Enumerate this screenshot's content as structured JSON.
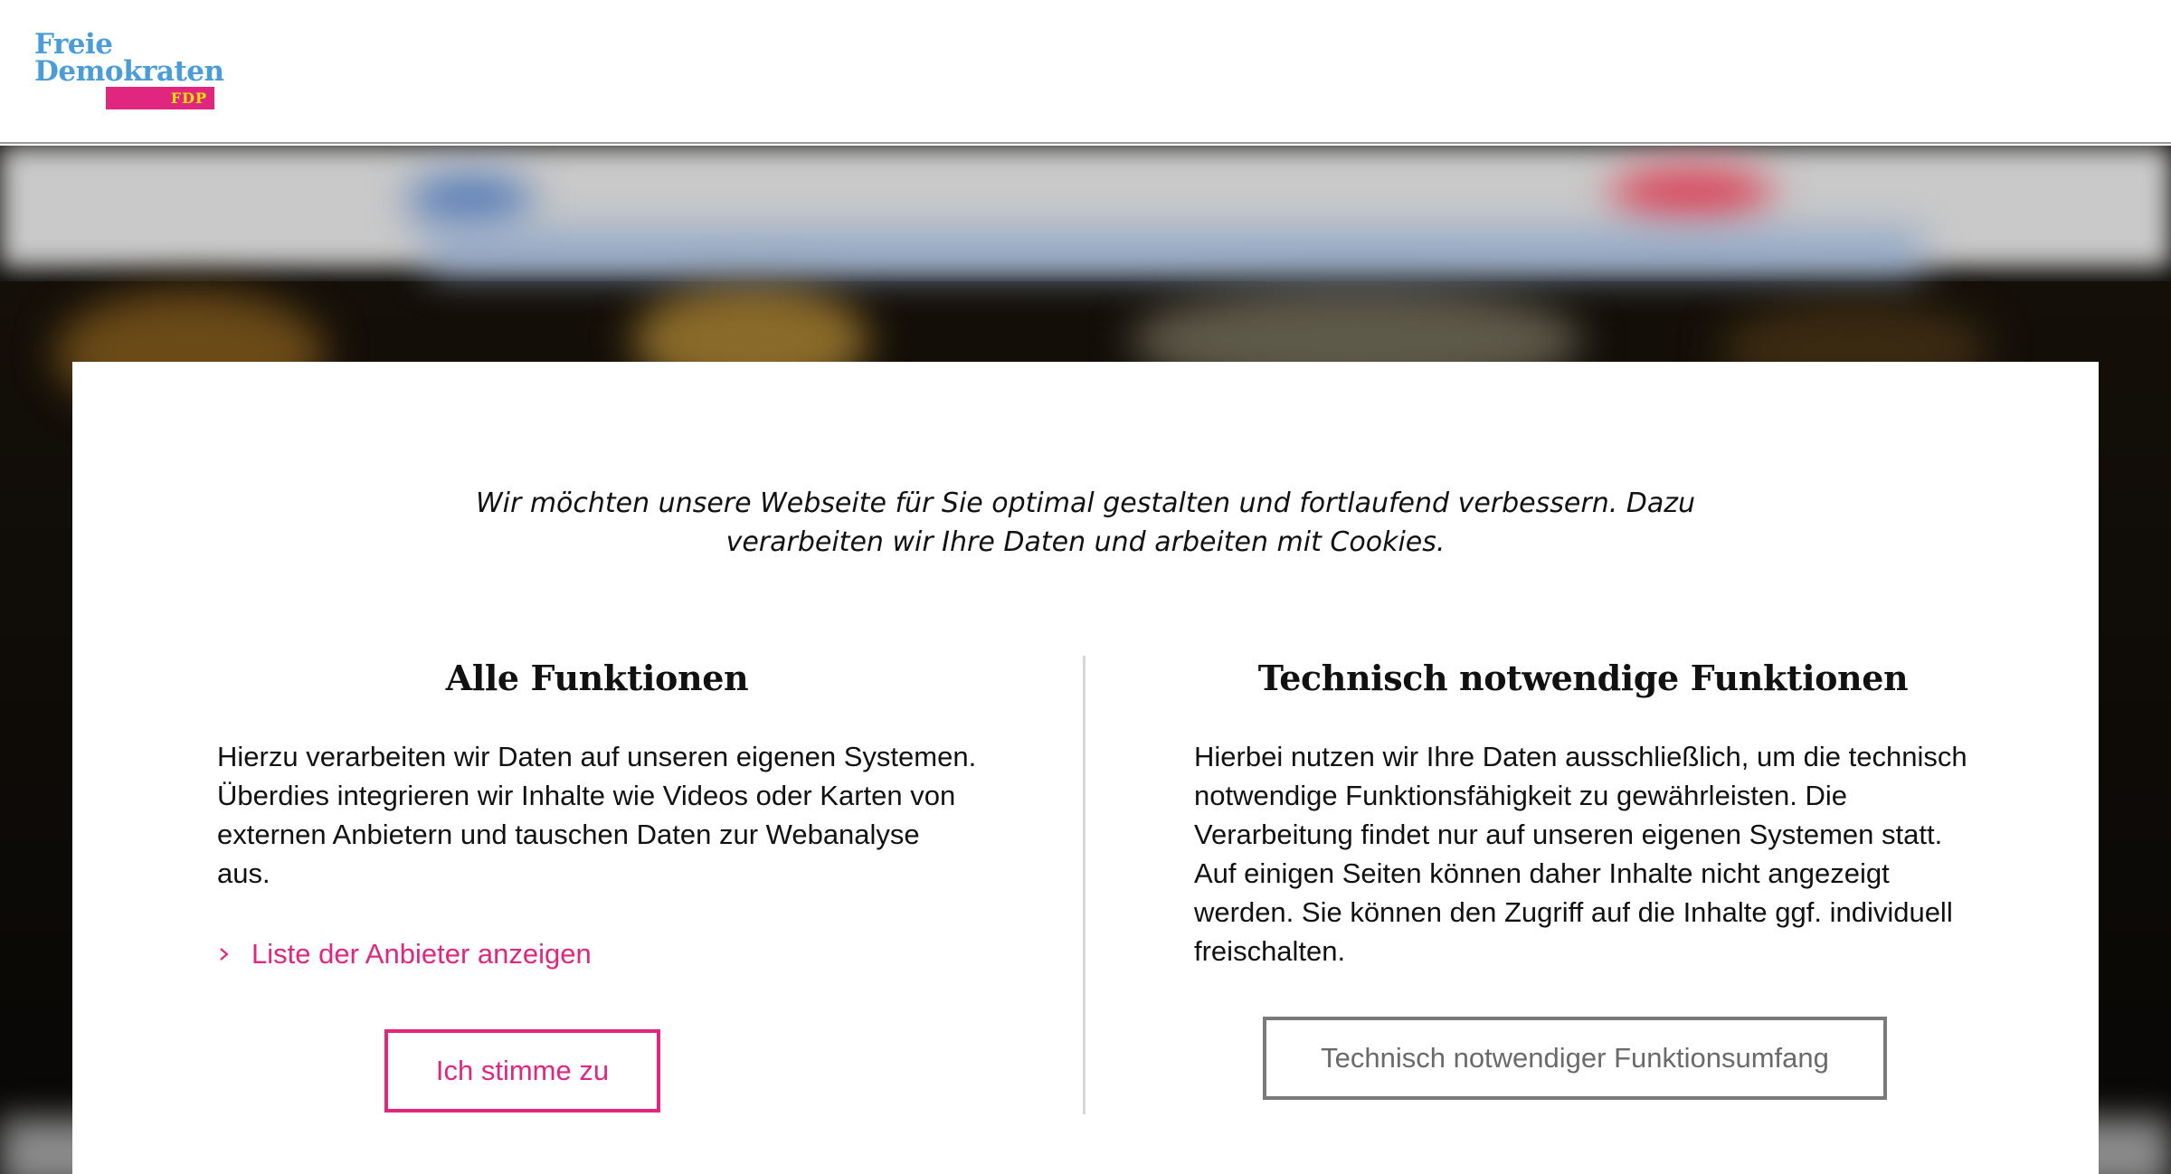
{
  "header": {
    "logo": {
      "line1": "Freie",
      "line2": "Demokraten",
      "badge": "FDP",
      "colors": {
        "text": "#4a9dd8",
        "badge_bg": "#e0267f",
        "badge_text": "#ffe600"
      }
    }
  },
  "consent": {
    "intro": "Wir möchten unsere Webseite für Sie optimal gestalten und fortlaufend verbessern. Dazu verarbeiten wir Ihre Daten und arbeiten mit Cookies.",
    "all": {
      "title": "Alle Funktionen",
      "text": "Hierzu verarbeiten wir Daten auf unseren eigenen Systemen. Überdies integrieren wir Inhalte wie Videos oder Karten von externen Anbietern und tauschen Daten zur Webanalyse aus.",
      "vendor_link": "Liste der Anbieter anzeigen",
      "vendor_icon": "chevron-right-icon",
      "button": "Ich stimme zu"
    },
    "technical": {
      "title": "Technisch notwendige Funktionen",
      "text": "Hierbei nutzen wir Ihre Daten ausschließlich, um die technisch notwendige Funktionsfähigkeit zu gewährleisten. Die Verarbeitung findet nur auf unseren eigenen Systemen statt. Auf einigen Seiten können daher Inhalte nicht angezeigt werden. Sie können den Zugriff auf die Inhalte ggf. individuell freischalten.",
      "button": "Technisch notwendiger Funktionsumfang"
    },
    "colors": {
      "accent": "#e0267f",
      "secondary_button": "#7a7a7a"
    }
  }
}
